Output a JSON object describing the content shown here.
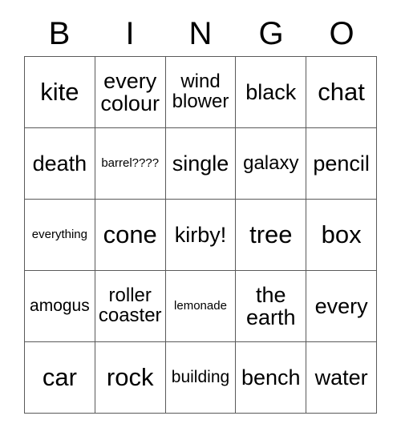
{
  "card": {
    "headers": [
      "B",
      "I",
      "N",
      "G",
      "O"
    ],
    "rows": [
      [
        {
          "text": "kite",
          "size": "fs-xl"
        },
        {
          "text": "every colour",
          "size": "fs-lg"
        },
        {
          "text": "wind blower",
          "size": "fs-md"
        },
        {
          "text": "black",
          "size": "fs-lg"
        },
        {
          "text": "chat",
          "size": "fs-xl"
        }
      ],
      [
        {
          "text": "death",
          "size": "fs-lg"
        },
        {
          "text": "barrel????",
          "size": "fs-xs"
        },
        {
          "text": "single",
          "size": "fs-lg"
        },
        {
          "text": "galaxy",
          "size": "fs-md"
        },
        {
          "text": "pencil",
          "size": "fs-lg"
        }
      ],
      [
        {
          "text": "everything",
          "size": "fs-xs"
        },
        {
          "text": "cone",
          "size": "fs-xl"
        },
        {
          "text": "kirby!",
          "size": "fs-lg"
        },
        {
          "text": "tree",
          "size": "fs-xl"
        },
        {
          "text": "box",
          "size": "fs-xl"
        }
      ],
      [
        {
          "text": "amogus",
          "size": "fs-sm"
        },
        {
          "text": "roller coaster",
          "size": "fs-md"
        },
        {
          "text": "lemonade",
          "size": "fs-xs"
        },
        {
          "text": "the earth",
          "size": "fs-lg"
        },
        {
          "text": "every",
          "size": "fs-lg"
        }
      ],
      [
        {
          "text": "car",
          "size": "fs-xl"
        },
        {
          "text": "rock",
          "size": "fs-xl"
        },
        {
          "text": "building",
          "size": "fs-sm"
        },
        {
          "text": "bench",
          "size": "fs-lg"
        },
        {
          "text": "water",
          "size": "fs-lg"
        }
      ]
    ],
    "colors": {
      "border": "#5a5a5a",
      "text": "#000000",
      "background": "#ffffff"
    }
  }
}
